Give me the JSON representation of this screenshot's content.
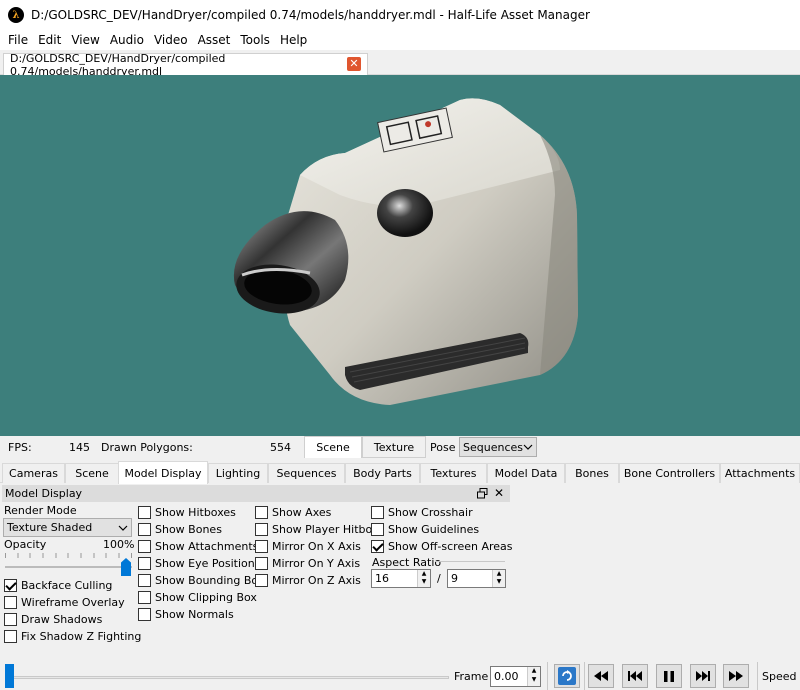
{
  "window": {
    "title": "D:/GOLDSRC_DEV/HandDryer/compiled 0.74/models/handdryer.mdl - Half-Life Asset Manager",
    "icon": "half-life-lambda-icon",
    "icon_glyph": "λ"
  },
  "menu": [
    "File",
    "Edit",
    "View",
    "Audio",
    "Video",
    "Asset",
    "Tools",
    "Help"
  ],
  "document_tab": {
    "label": "D:/GOLDSRC_DEV/HandDryer/compiled 0.74/models/handdryer.mdl",
    "close_glyph": "✕"
  },
  "viewport": {
    "background_color": "#3d7f7c",
    "subject": "hand-dryer-model"
  },
  "info_bar": {
    "fps_label": "FPS:",
    "fps_value": "145",
    "polygons_label": "Drawn Polygons:",
    "polygons_value": "554",
    "mode_tabs": [
      "Scene",
      "Texture"
    ],
    "active_mode": "Scene",
    "pose_label": "Pose",
    "pose_value": "Sequences"
  },
  "panel_tabs": [
    "Cameras",
    "Scene",
    "Model Display",
    "Lighting",
    "Sequences",
    "Body Parts",
    "Textures",
    "Model Data",
    "Bones",
    "Bone Controllers",
    "Attachments"
  ],
  "active_panel_tab": "Model Display",
  "dock": {
    "title": "Model Display",
    "render_mode_label": "Render Mode",
    "render_mode_value": "Texture Shaded",
    "opacity_label": "Opacity",
    "opacity_value_text": "100%",
    "opacity_value": 1.0,
    "column1": [
      {
        "label": "Backface Culling",
        "checked": true
      },
      {
        "label": "Wireframe Overlay",
        "checked": false
      },
      {
        "label": "Draw Shadows",
        "checked": false
      },
      {
        "label": "Fix Shadow Z Fighting",
        "checked": false
      }
    ],
    "column2": [
      {
        "label": "Show Hitboxes",
        "checked": false
      },
      {
        "label": "Show Bones",
        "checked": false
      },
      {
        "label": "Show Attachments",
        "checked": false
      },
      {
        "label": "Show Eye Position",
        "checked": false
      },
      {
        "label": "Show Bounding Box",
        "checked": false
      },
      {
        "label": "Show Clipping Box",
        "checked": false
      },
      {
        "label": "Show Normals",
        "checked": false
      }
    ],
    "column3": [
      {
        "label": "Show Axes",
        "checked": false
      },
      {
        "label": "Show Player Hitbox",
        "checked": false
      },
      {
        "label": "Mirror On X Axis",
        "checked": false
      },
      {
        "label": "Mirror On Y Axis",
        "checked": false
      },
      {
        "label": "Mirror On Z Axis",
        "checked": false
      }
    ],
    "column4": [
      {
        "label": "Show Crosshair",
        "checked": false
      },
      {
        "label": "Show Guidelines",
        "checked": false
      },
      {
        "label": "Show Off-screen Areas",
        "checked": true
      }
    ],
    "aspect_ratio_label": "Aspect Ratio",
    "aspect_width": "16",
    "aspect_height": "9",
    "aspect_separator": "/"
  },
  "playback": {
    "frame_label": "Frame",
    "frame_value": "0.00",
    "frame_position": 0,
    "speed_label": "Speed",
    "buttons": [
      "restart-icon",
      "rewind-icon",
      "previous-frame-icon",
      "pause-icon",
      "next-frame-icon",
      "fast-forward-icon"
    ]
  },
  "colors": {
    "accent": "#0078d7",
    "viewport_bg": "#3d7f7c",
    "close_button": "#e0562f"
  }
}
